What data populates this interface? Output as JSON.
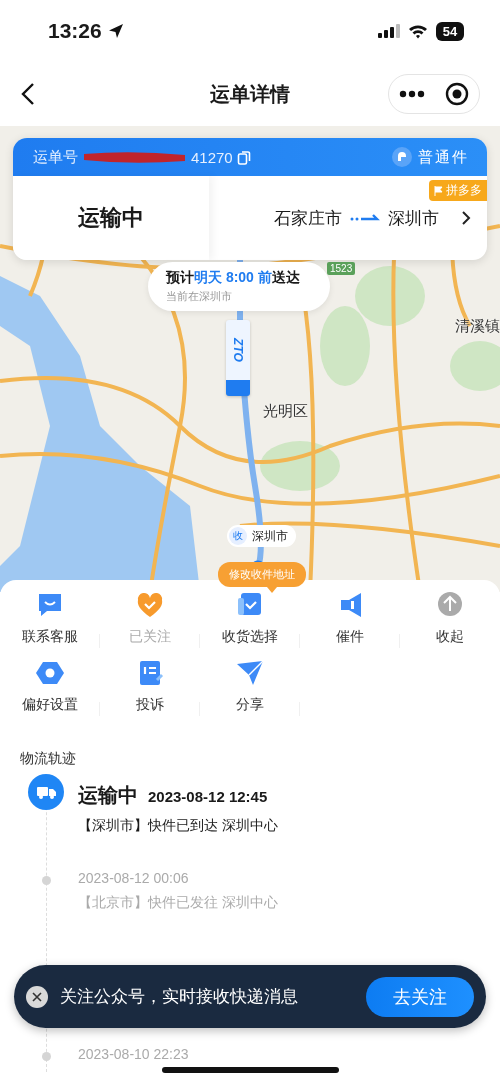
{
  "status_bar": {
    "time": "13:26",
    "battery": "54"
  },
  "nav": {
    "title": "运单详情"
  },
  "waybill": {
    "label": "运单号",
    "number_tail": "41270",
    "service": "普通件",
    "status": "运输中",
    "origin": "石家庄市",
    "destination": "深圳市",
    "platform_tag": "拼多多"
  },
  "eta": {
    "text": "预计**明天 8:00 前**送达",
    "current_location": "当前在深圳市"
  },
  "map": {
    "labels": [
      {
        "text": "光明区",
        "kind": "district"
      },
      {
        "text": "清溪镇",
        "kind": "town"
      }
    ],
    "road_sign": "1523",
    "courier_marker": "ZTO",
    "destination_pin": {
      "badge": "收",
      "city": "深圳市"
    }
  },
  "tooltip": "修改收件地址",
  "actions": [
    {
      "label": "联系客服",
      "kind": "chat",
      "disabled": false
    },
    {
      "label": "已关注",
      "kind": "heart",
      "disabled": true
    },
    {
      "label": "收货选择",
      "kind": "check",
      "disabled": false
    },
    {
      "label": "催件",
      "kind": "megaphone",
      "disabled": false
    },
    {
      "label": "收起",
      "kind": "collapse",
      "disabled": false
    },
    {
      "label": "偏好设置",
      "kind": "hexagon",
      "disabled": false
    },
    {
      "label": "投诉",
      "kind": "note",
      "disabled": false
    },
    {
      "label": "分享",
      "kind": "plane",
      "disabled": false
    }
  ],
  "tracking": {
    "title": "物流轨迹",
    "events": [
      {
        "status": "运输中",
        "time": "2023-08-12 12:45",
        "detail": "【深圳市】快件已到达 深圳中心",
        "current": true
      },
      {
        "time": "2023-08-12 00:06",
        "detail": "【北京市】快件已发往 深圳中心",
        "current": false
      },
      {
        "time": "2023-08-10 22:23",
        "current": false
      }
    ]
  },
  "toast": {
    "message": "关注公众号，实时接收快递消息",
    "button": "去关注"
  }
}
